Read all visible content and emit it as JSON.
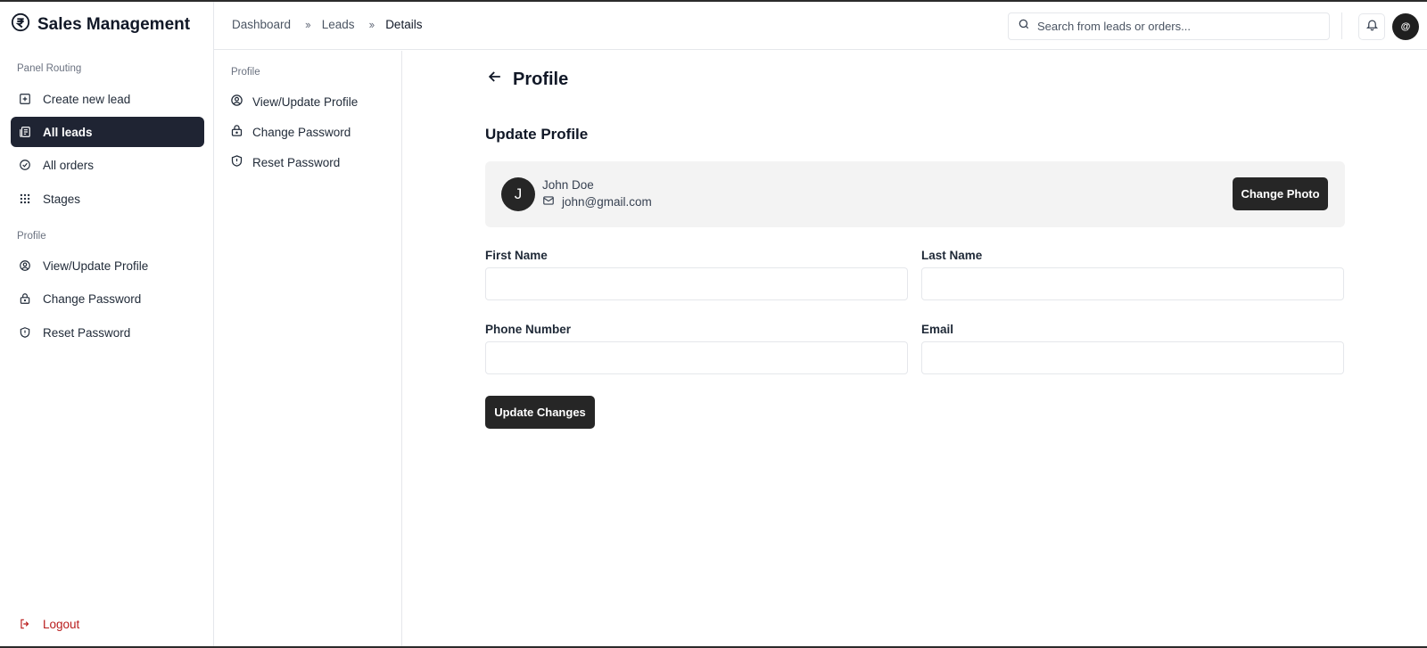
{
  "app": {
    "title": "Sales Management"
  },
  "sidebar": {
    "section_routing": "Panel Routing",
    "routing_items": [
      {
        "label": "Create new lead",
        "icon": "plus-square-icon"
      },
      {
        "label": "All leads",
        "icon": "newspaper-icon",
        "active": true
      },
      {
        "label": "All orders",
        "icon": "circle-check-icon"
      },
      {
        "label": "Stages",
        "icon": "grip-icon"
      }
    ],
    "section_profile": "Profile",
    "profile_items": [
      {
        "label": "View/Update Profile",
        "icon": "user-circle-icon"
      },
      {
        "label": "Change Password",
        "icon": "lock-icon"
      },
      {
        "label": "Reset Password",
        "icon": "shield-icon"
      }
    ],
    "logout_label": "Logout"
  },
  "subpanel": {
    "label": "Profile",
    "items": [
      {
        "label": "View/Update Profile",
        "icon": "user-circle-icon"
      },
      {
        "label": "Change Password",
        "icon": "lock-icon"
      },
      {
        "label": "Reset Password",
        "icon": "shield-icon"
      }
    ]
  },
  "header": {
    "breadcrumb": [
      "Dashboard",
      "Leads",
      "Details"
    ],
    "search_placeholder": "Search from leads or orders...",
    "avatar_label": "@"
  },
  "main": {
    "page_title": "Profile",
    "section_title": "Update Profile",
    "profile": {
      "initial": "J",
      "name": "John Doe",
      "email": "john@gmail.com",
      "change_photo_label": "Change Photo"
    },
    "form": {
      "first_name_label": "First Name",
      "first_name_value": "",
      "last_name_label": "Last Name",
      "last_name_value": "",
      "phone_label": "Phone Number",
      "phone_value": "",
      "email_label": "Email",
      "email_value": "",
      "submit_label": "Update Changes"
    }
  },
  "colors": {
    "active_bg": "#1f2433",
    "button_bg": "#262626",
    "logout": "#b91c1c",
    "card_bg": "#f3f3f3"
  }
}
